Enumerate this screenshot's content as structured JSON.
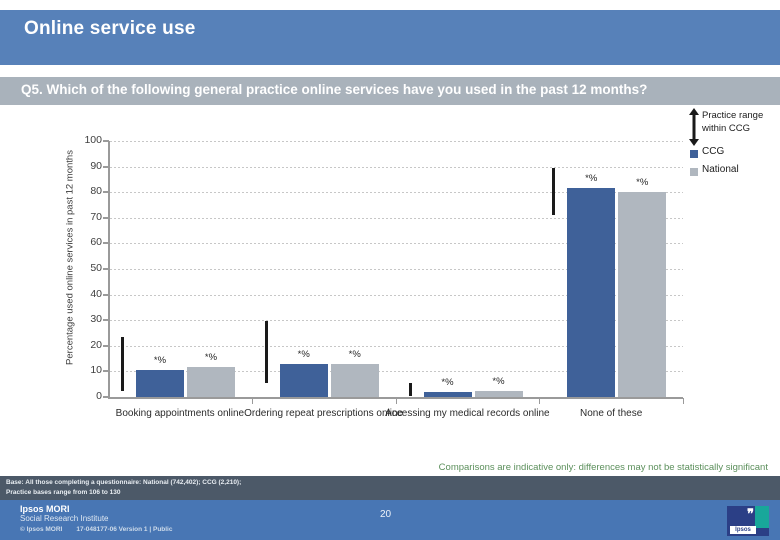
{
  "slide": {
    "title": "Online service use",
    "question": "Q5. Which of the following general practice online services have you used in the past 12 months?",
    "page_number": "20",
    "note": "Comparisons are indicative only: differences may not be statistically significant",
    "base_line1": "Base: All those completing a questionnaire: National (742,402); CCG (2,210);",
    "base_line2": "Practice bases range from 106 to 130"
  },
  "footer": {
    "brand": "Ipsos MORI",
    "sub": "Social Research Institute",
    "copyright": "© Ipsos MORI",
    "version": "17-048177-06 Version 1 | Public",
    "logo_word": "Ipsos"
  },
  "legend": {
    "range_label_line1": "Practice range",
    "range_label_line2": "within CCG",
    "keys": [
      {
        "label": "CCG",
        "color": "#3f6199"
      },
      {
        "label": "National",
        "color": "#b0b7bf"
      }
    ]
  },
  "colors": {
    "title_bar": "#5781b9",
    "question_band": "#a9b2bb",
    "ccg": "#3f6199",
    "national": "#b0b7bf",
    "range": "#1a1a1a",
    "base_band": "#4c5968",
    "footer": "#4876b4",
    "note": "#5b8f5b"
  },
  "chart_data": {
    "type": "bar",
    "title": "",
    "xlabel": "",
    "ylabel": "Percentage used online services in past 12 months",
    "ylim": [
      0,
      100
    ],
    "yticks": [
      0,
      10,
      20,
      30,
      40,
      50,
      60,
      70,
      80,
      90,
      100
    ],
    "ytick_labels": [
      "0",
      "10",
      "20",
      "30",
      "40",
      "50",
      "60",
      "70",
      "80",
      "90",
      "100"
    ],
    "grid": true,
    "legend_position": "right",
    "categories": [
      "Booking appointments online",
      "Ordering repeat prescriptions online",
      "Accessing my medical records online",
      "None of these"
    ],
    "series": [
      {
        "name": "CCG",
        "color": "#3f6199",
        "values": [
          10.5,
          13,
          2,
          81.5
        ],
        "data_labels": [
          "*%",
          "*%",
          "*%",
          "*%"
        ]
      },
      {
        "name": "National",
        "color": "#b0b7bf",
        "values": [
          11.7,
          13,
          2.5,
          80
        ],
        "data_labels": [
          "*%",
          "*%",
          "*%",
          "*%"
        ]
      }
    ],
    "practice_range_within_ccg": [
      {
        "category": "Booking appointments online",
        "low": 2.5,
        "high": 23.5
      },
      {
        "category": "Ordering repeat prescriptions online",
        "low": 5.5,
        "high": 29.5
      },
      {
        "category": "Accessing my medical records online",
        "low": 0.5,
        "high": 5.5
      },
      {
        "category": "None of these",
        "low": 71,
        "high": 89.5
      }
    ]
  }
}
